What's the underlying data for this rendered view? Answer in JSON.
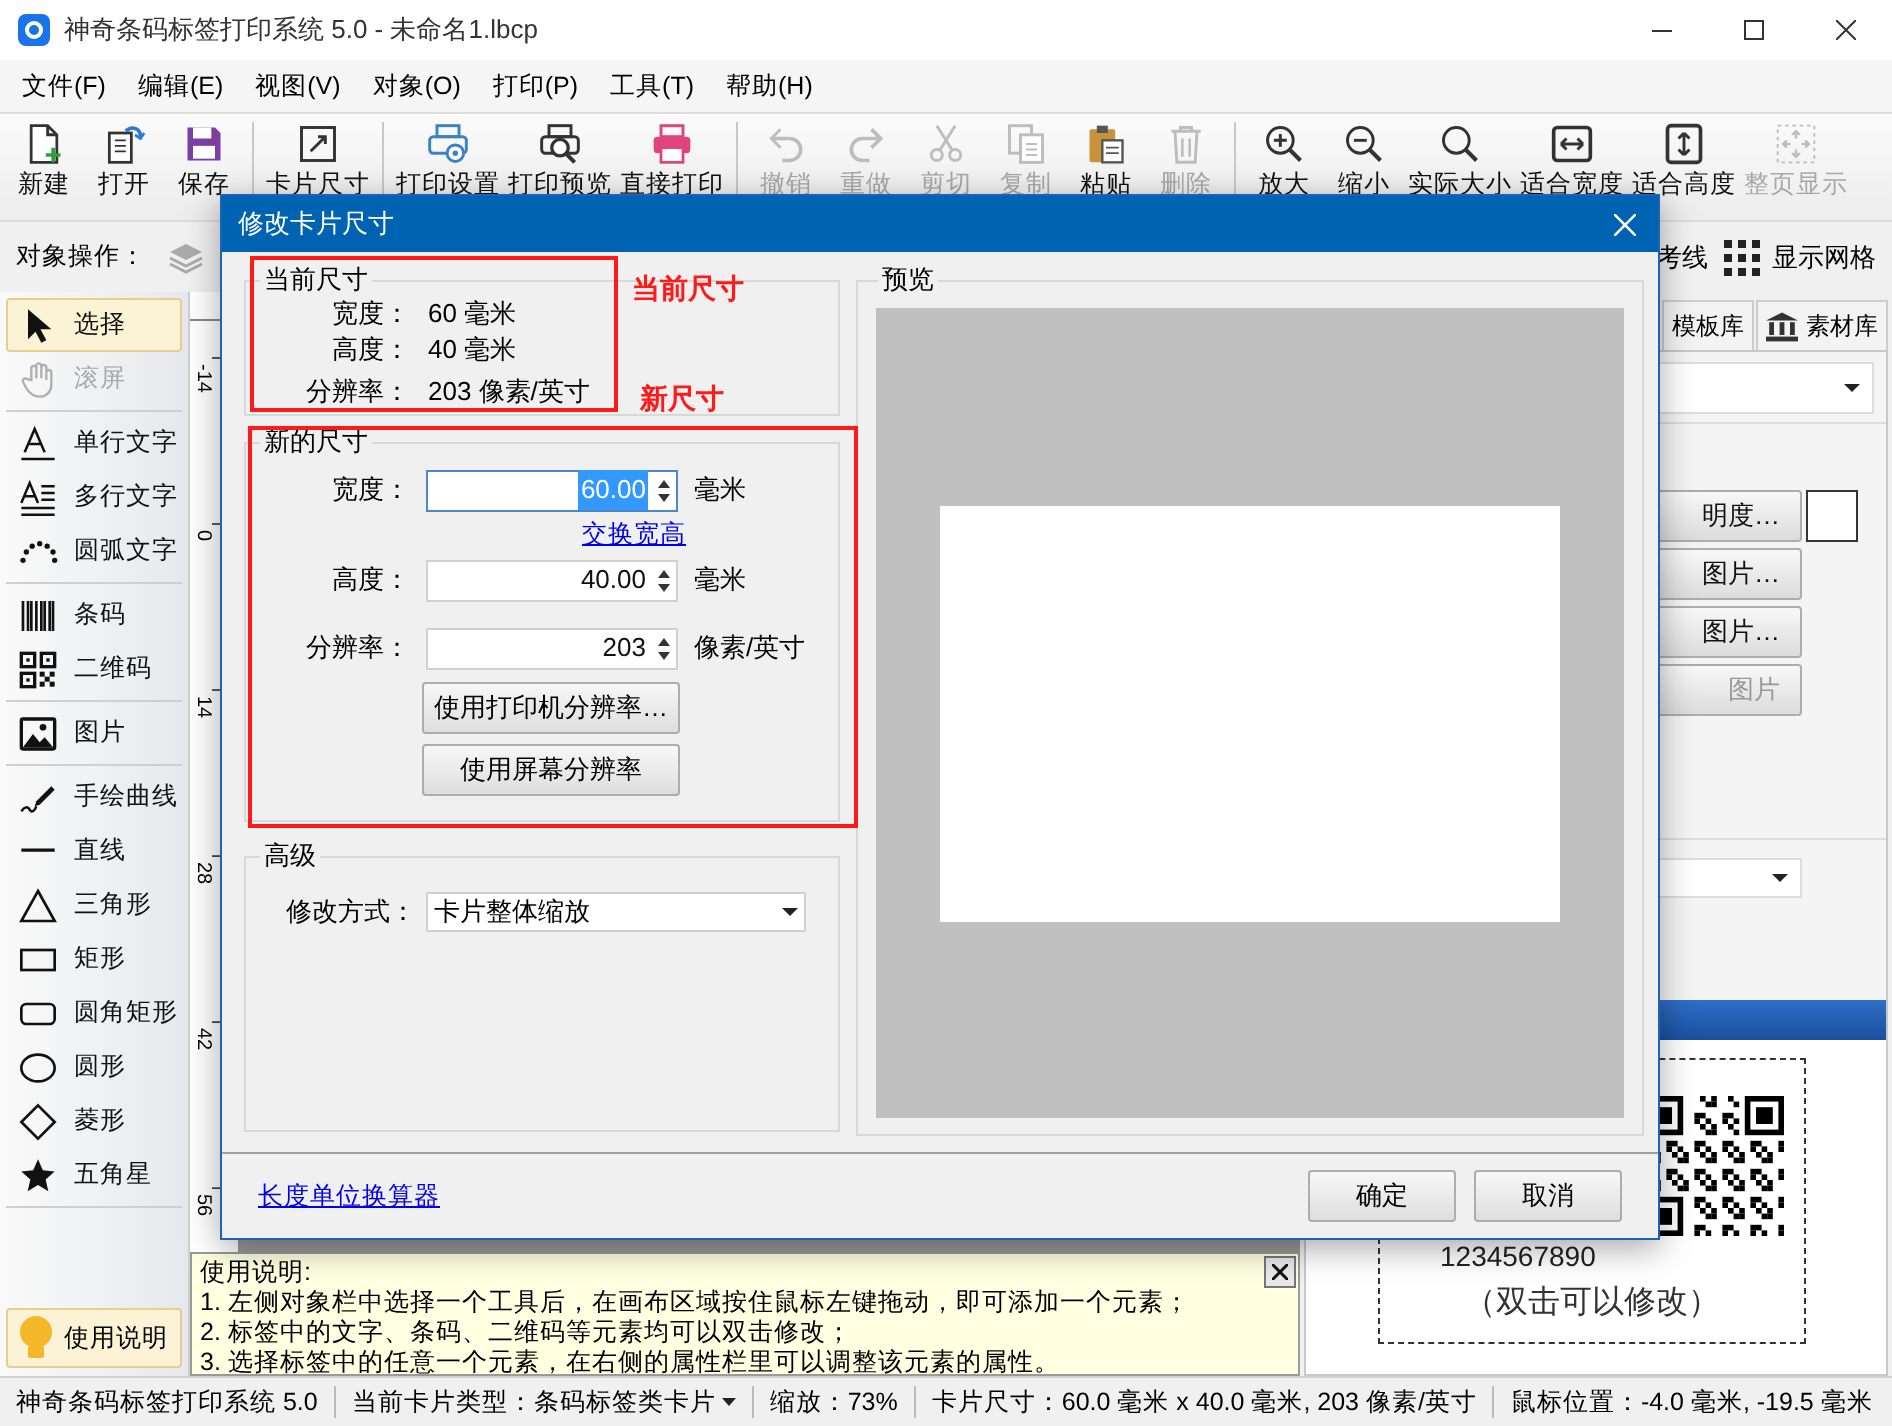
{
  "window": {
    "title": "神奇条码标签打印系统 5.0 - 未命名1.lbcp"
  },
  "menu": [
    "文件(F)",
    "编辑(E)",
    "视图(V)",
    "对象(O)",
    "打印(P)",
    "工具(T)",
    "帮助(H)"
  ],
  "toolbar": [
    [
      {
        "label": "新建",
        "kind": "new",
        "disabled": false
      },
      {
        "label": "打开",
        "kind": "open",
        "disabled": false
      },
      {
        "label": "保存",
        "kind": "save",
        "disabled": false
      }
    ],
    [
      {
        "label": "卡片尺寸",
        "kind": "cardsize",
        "disabled": false
      }
    ],
    [
      {
        "label": "打印设置",
        "kind": "printset",
        "disabled": false
      },
      {
        "label": "打印预览",
        "kind": "preview",
        "disabled": false
      },
      {
        "label": "直接打印",
        "kind": "print",
        "disabled": false
      }
    ],
    [
      {
        "label": "撤销",
        "kind": "undo",
        "disabled": true
      },
      {
        "label": "重做",
        "kind": "redo",
        "disabled": true
      },
      {
        "label": "剪切",
        "kind": "cut",
        "disabled": true
      },
      {
        "label": "复制",
        "kind": "copy",
        "disabled": true
      },
      {
        "label": "粘贴",
        "kind": "paste",
        "disabled": false
      },
      {
        "label": "删除",
        "kind": "delete",
        "disabled": true
      }
    ],
    [
      {
        "label": "放大",
        "kind": "zoomin",
        "disabled": false
      },
      {
        "label": "缩小",
        "kind": "zoomout",
        "disabled": false
      },
      {
        "label": "实际大小",
        "kind": "actual",
        "disabled": false
      },
      {
        "label": "适合宽度",
        "kind": "fitw",
        "disabled": false
      },
      {
        "label": "适合高度",
        "kind": "fith",
        "disabled": false
      },
      {
        "label": "整页显示",
        "kind": "fitpage",
        "disabled": true
      }
    ]
  ],
  "object_bar": {
    "label": "对象操作：",
    "guides": "考线",
    "grid": "显示网格"
  },
  "tool_groups": [
    [
      {
        "label": "选择",
        "kind": "pointer",
        "selected": true,
        "disabled": false
      },
      {
        "label": "滚屏",
        "kind": "hand",
        "selected": false,
        "disabled": true
      }
    ],
    [
      {
        "label": "单行文字",
        "kind": "text1",
        "selected": false,
        "disabled": false
      },
      {
        "label": "多行文字",
        "kind": "textm",
        "selected": false,
        "disabled": false
      },
      {
        "label": "圆弧文字",
        "kind": "arc",
        "selected": false,
        "disabled": false
      }
    ],
    [
      {
        "label": "条码",
        "kind": "barcode",
        "selected": false,
        "disabled": false
      },
      {
        "label": "二维码",
        "kind": "qr",
        "selected": false,
        "disabled": false
      }
    ],
    [
      {
        "label": "图片",
        "kind": "image",
        "selected": false,
        "disabled": false
      }
    ],
    [
      {
        "label": "手绘曲线",
        "kind": "pen",
        "selected": false,
        "disabled": false
      },
      {
        "label": "直线",
        "kind": "line",
        "selected": false,
        "disabled": false
      },
      {
        "label": "三角形",
        "kind": "triangle",
        "selected": false,
        "disabled": false
      },
      {
        "label": "矩形",
        "kind": "rect",
        "selected": false,
        "disabled": false
      },
      {
        "label": "圆角矩形",
        "kind": "roundrect",
        "selected": false,
        "disabled": false
      },
      {
        "label": "圆形",
        "kind": "ellipse",
        "selected": false,
        "disabled": false
      },
      {
        "label": "菱形",
        "kind": "diamond",
        "selected": false,
        "disabled": false
      },
      {
        "label": "五角星",
        "kind": "star",
        "selected": false,
        "disabled": false
      }
    ]
  ],
  "help_button": "使用说明",
  "ruler": {
    "labels": [
      "-14",
      "0",
      "14",
      "28",
      "42",
      "56"
    ]
  },
  "help": {
    "title": "使用说明:",
    "lines": [
      "1. 左侧对象栏中选择一个工具后，在画布区域按住鼠标左键拖动，即可添加一个元素；",
      "2. 标签中的文字、条码、二维码等元素均可以双击修改；",
      "3. 选择标签中的任意一个元素，在右侧的属性栏里可以调整该元素的属性。"
    ]
  },
  "right_panel": {
    "tabs": [
      {
        "label": "模板库",
        "selected": false
      },
      {
        "label": "素材库",
        "selected": false
      }
    ],
    "buttons": [
      {
        "label": "明度…",
        "disabled": false
      },
      {
        "label": "图片…",
        "disabled": false
      },
      {
        "label": "图片…",
        "disabled": false
      },
      {
        "label": "图片",
        "disabled": true
      }
    ],
    "label_preview": {
      "code": "1234567890",
      "hint": "（双击可以修改）"
    }
  },
  "status_bar": {
    "app": "神奇条码标签打印系统 5.0",
    "card_type": "当前卡片类型：条码标签类卡片",
    "zoom": "缩放：73%",
    "card_size": "卡片尺寸：60.0 毫米 x 40.0 毫米, 203 像素/英寸",
    "mouse": "鼠标位置：-4.0 毫米, -19.5 毫米"
  },
  "dialog": {
    "title": "修改卡片尺寸",
    "current_size": {
      "title": "当前尺寸",
      "rows": [
        {
          "label": "宽度：",
          "value": "60 毫米"
        },
        {
          "label": "高度：",
          "value": "40 毫米"
        },
        {
          "label": "分辨率：",
          "value": "203 像素/英寸"
        }
      ]
    },
    "new_size": {
      "title": "新的尺寸",
      "fields": [
        {
          "label": "宽度：",
          "value": "60.00",
          "unit": "毫米",
          "selected": true
        },
        {
          "label": "高度：",
          "value": "40.00",
          "unit": "毫米",
          "selected": false
        },
        {
          "label": "分辨率：",
          "value": "203",
          "unit": "像素/英寸",
          "selected": false
        }
      ],
      "swap_link": "交换宽高",
      "buttons": [
        "使用打印机分辨率…",
        "使用屏幕分辨率"
      ]
    },
    "advanced": {
      "title": "高级",
      "mode_label": "修改方式：",
      "mode_value": "卡片整体缩放"
    },
    "preview": {
      "title": "预览"
    },
    "footer": {
      "link": "长度单位换算器",
      "buttons": [
        "确定",
        "取消"
      ]
    }
  },
  "annotations": [
    {
      "text": "当前尺寸"
    },
    {
      "text": "新尺寸"
    }
  ]
}
